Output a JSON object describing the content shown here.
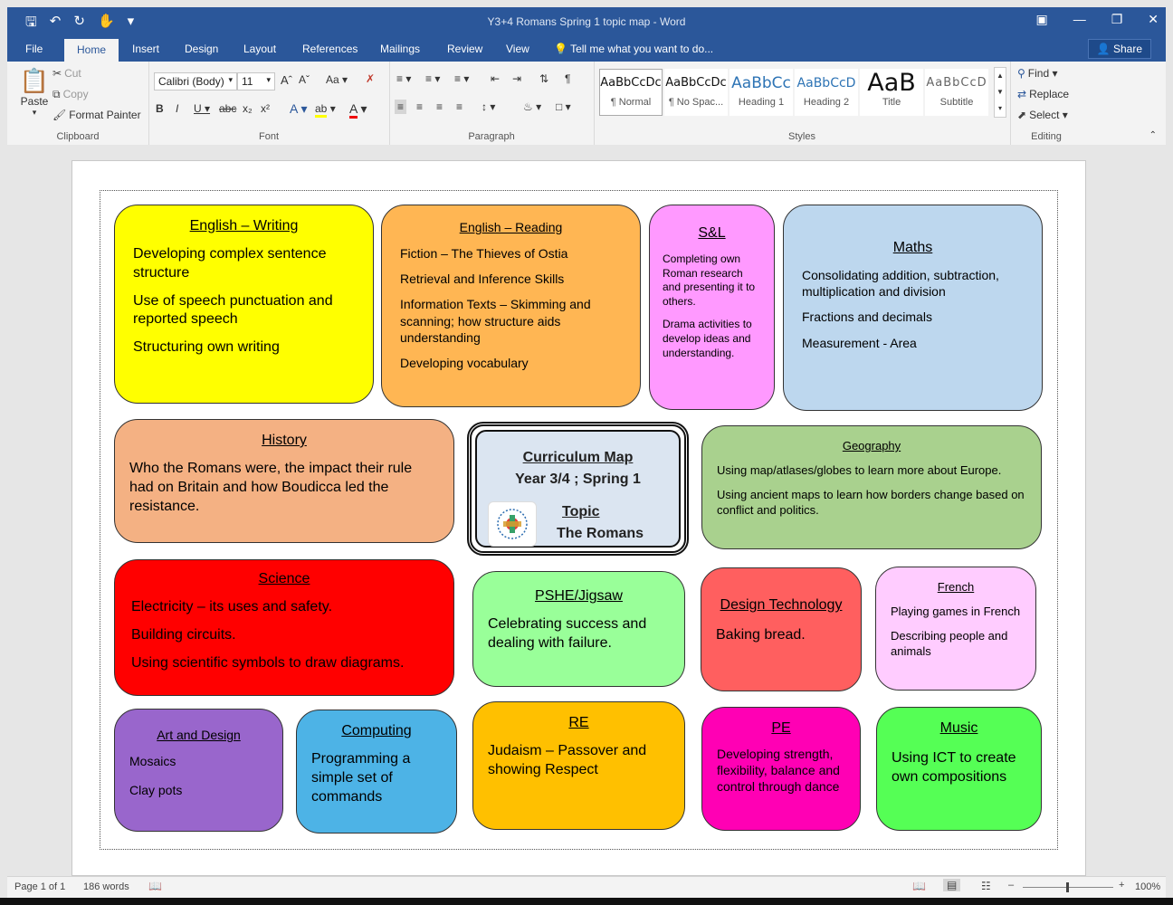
{
  "window": {
    "title": "Y3+4 Romans Spring 1 topic map - Word"
  },
  "tabs": [
    "File",
    "Home",
    "Insert",
    "Design",
    "Layout",
    "References",
    "Mailings",
    "Review",
    "View"
  ],
  "tell_me": "Tell me what you want to do...",
  "share": "Share",
  "clipboard": {
    "paste": "Paste",
    "cut": "Cut",
    "copy": "Copy",
    "format_painter": "Format Painter",
    "label": "Clipboard"
  },
  "font": {
    "name": "Calibri (Body)",
    "size": "11",
    "label": "Font"
  },
  "paragraph": {
    "label": "Paragraph"
  },
  "styles": {
    "label": "Styles",
    "items": [
      {
        "preview": "AaBbCcDc",
        "name": "¶ Normal"
      },
      {
        "preview": "AaBbCcDc",
        "name": "¶ No Spac..."
      },
      {
        "preview": "AaBbCc",
        "name": "Heading 1"
      },
      {
        "preview": "AaBbCcD",
        "name": "Heading 2"
      },
      {
        "preview": "AaB",
        "name": "Title"
      },
      {
        "preview": "AaBbCcD",
        "name": "Subtitle"
      }
    ]
  },
  "editing": {
    "find": "Find",
    "replace": "Replace",
    "select": "Select",
    "label": "Editing"
  },
  "boxes": {
    "english_writing": {
      "title": "English – Writing",
      "lines": [
        "Developing complex sentence structure",
        "Use of speech punctuation and reported speech",
        "Structuring own writing"
      ]
    },
    "english_reading": {
      "title": "English – Reading",
      "lines": [
        "Fiction – The Thieves of Ostia",
        "Retrieval and Inference Skills",
        "Information Texts – Skimming and scanning; how structure aids understanding",
        "Developing vocabulary"
      ]
    },
    "sl": {
      "title": "S&L",
      "lines": [
        "Completing own Roman research and presenting it to others.",
        "Drama activities to develop ideas and understanding."
      ]
    },
    "maths": {
      "title": "Maths",
      "lines": [
        "Consolidating addition, subtraction, multiplication and division",
        "Fractions and decimals",
        "Measurement - Area"
      ]
    },
    "history": {
      "title": "History",
      "lines": [
        "Who the Romans were, the impact their rule had on Britain and how Boudicca led the resistance."
      ]
    },
    "geography": {
      "title": "Geography",
      "lines": [
        "Using map/atlases/globes to learn more about Europe.",
        "Using ancient maps to learn how borders change based on conflict and politics."
      ]
    },
    "science": {
      "title": "Science",
      "lines": [
        "Electricity – its uses and safety.",
        "Building circuits.",
        "Using scientific symbols to draw diagrams."
      ]
    },
    "pshe": {
      "title": "PSHE/Jigsaw",
      "lines": [
        "Celebrating success and dealing with failure."
      ]
    },
    "dt": {
      "title": "Design Technology",
      "lines": [
        "Baking bread."
      ]
    },
    "french": {
      "title": "French",
      "lines": [
        "Playing games in French",
        "Describing people and animals"
      ]
    },
    "art": {
      "title": "Art and Design",
      "lines": [
        "Mosaics",
        "Clay pots"
      ]
    },
    "computing": {
      "title": "Computing",
      "lines": [
        "Programming a simple set of commands"
      ]
    },
    "re": {
      "title": "RE",
      "lines": [
        "Judaism – Passover and showing Respect"
      ]
    },
    "pe": {
      "title": "PE",
      "lines": [
        "Developing strength, flexibility, balance and control through dance"
      ]
    },
    "music": {
      "title": "Music",
      "lines": [
        "Using ICT to create own compositions"
      ]
    }
  },
  "centre": {
    "line1": "Curriculum Map",
    "line2": "Year 3/4 ;  Spring 1",
    "line3": "Topic",
    "line4": "The Romans"
  },
  "status": {
    "page": "Page 1 of 1",
    "words": "186 words",
    "zoom": "100%"
  },
  "colors": {
    "english_writing": "#ffff00",
    "english_reading": "#ffb653",
    "sl": "#ff99ff",
    "maths": "#bdd7ee",
    "history": "#f4b183",
    "geography": "#a9d18e",
    "science": "#ff0000",
    "pshe": "#99ff99",
    "dt": "#ff5f5f",
    "french": "#ffccff",
    "art": "#9966cc",
    "computing": "#4db3e6",
    "re": "#ffc000",
    "pe": "#ff00b4",
    "music": "#55ff55"
  }
}
